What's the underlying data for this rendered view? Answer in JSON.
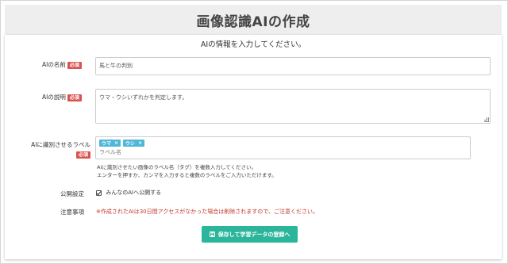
{
  "page": {
    "title": "画像認識AIの作成"
  },
  "form": {
    "intro": "AIの情報を入力してください。",
    "required_label": "必須",
    "name": {
      "label": "AIの名前",
      "value": "馬と牛の判別"
    },
    "description": {
      "label": "AIの説明",
      "value": "ウマ・ウシいずれかを判定します。"
    },
    "labels": {
      "label": "AIに識別させるラベル",
      "tags": [
        {
          "text": "ウマ",
          "remove": "×"
        },
        {
          "text": "ウシ",
          "remove": "×"
        }
      ],
      "placeholder": "ラベル名",
      "help_line1": "AIに識別させたい画像のラベル名（タグ）を複数入力してください。",
      "help_line2": "エンターを押すか、カンマを入力すると複数のラベルをご入力いただけます。"
    },
    "visibility": {
      "label": "公開設定",
      "checkbox_label": "みんなのAIへ公開する",
      "checked": true
    },
    "caution": {
      "label": "注意事項",
      "text": "※作成されたAIは30日間アクセスがなかった場合は削除されますので、ご注意ください。"
    },
    "submit_label": "保存して学習データの登録へ"
  },
  "colors": {
    "required_badge": "#d9534f",
    "tag": "#4fb8d8",
    "submit": "#2bb59a",
    "caution_text": "#c0392b",
    "header_bg": "#eeeeee"
  },
  "icons": {
    "submit": "save-icon"
  }
}
